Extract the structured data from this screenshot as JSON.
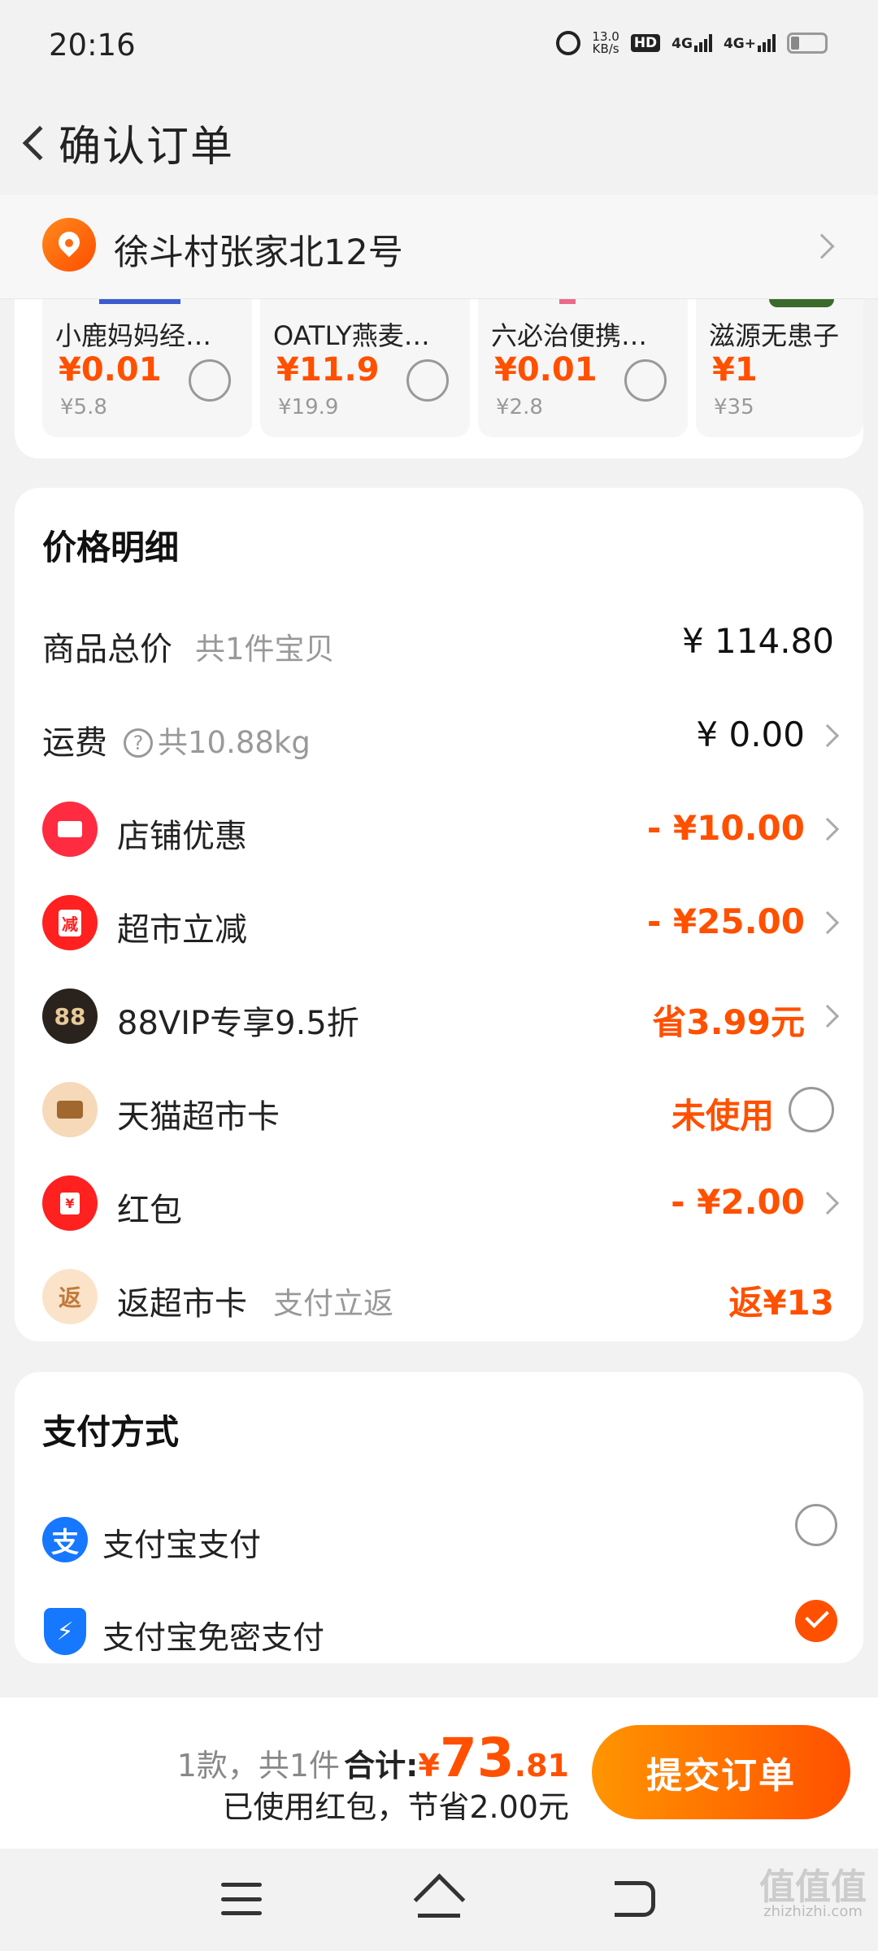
{
  "status_bar": {
    "time": "20:16",
    "net_speed_value": "13.0",
    "net_speed_unit": "KB/s",
    "hd_label": "HD",
    "network1": "4G",
    "network2": "4G+"
  },
  "header": {
    "title": "确认订单"
  },
  "address": {
    "text": "徐斗村张家北12号"
  },
  "products": [
    {
      "name": "小鹿妈妈经…",
      "price": "¥0.01",
      "original": "¥5.8",
      "strip": "#3b5bd0"
    },
    {
      "name": "OATLY燕麦…",
      "price": "¥11.9",
      "original": "¥19.9",
      "strip": "#f2f2f2"
    },
    {
      "name": "六必治便携…",
      "price": "¥0.01",
      "original": "¥2.8",
      "strip": "#e96a8a"
    },
    {
      "name": "滋源无患子",
      "price": "¥1",
      "original": "¥35",
      "strip": "#3b6a2a"
    }
  ],
  "price_detail": {
    "title": "价格明细",
    "rows": [
      {
        "label": "商品总价",
        "sub": "共1件宝贝",
        "value": "¥ 114.80"
      },
      {
        "label": "运费",
        "help": "?",
        "sub": "共10.88kg",
        "value": "¥ 0.00"
      },
      {
        "label": "店铺优惠",
        "value": "- ¥10.00"
      },
      {
        "label": "超市立减",
        "icon_text": "减",
        "value": "- ¥25.00"
      },
      {
        "label": "88VIP专享9.5折",
        "icon_text": "88",
        "value": "省3.99元"
      },
      {
        "label": "天猫超市卡",
        "value": "未使用"
      },
      {
        "label": "红包",
        "icon_text": "¥",
        "value": "- ¥2.00"
      },
      {
        "label": "返超市卡",
        "icon_text": "返",
        "sub": "支付立返",
        "value": "返¥13"
      }
    ]
  },
  "payment": {
    "title": "支付方式",
    "alipay_icon": "支",
    "options": [
      {
        "label": "支付宝支付",
        "selected": false
      },
      {
        "label": "支付宝免密支付",
        "selected": true
      }
    ]
  },
  "bottom": {
    "count": "1款，共1件",
    "total_label": "合计:",
    "currency": "¥",
    "total_int": "73",
    "total_dec": ".81",
    "saved": "已使用红包，节省2.00元",
    "submit": "提交订单"
  },
  "watermark": {
    "main": "值值值",
    "sub": "zhizhizhi.com"
  },
  "colors": {
    "accent": "#ff5000",
    "alipay": "#1677ff",
    "background": "#f2f2f2"
  }
}
